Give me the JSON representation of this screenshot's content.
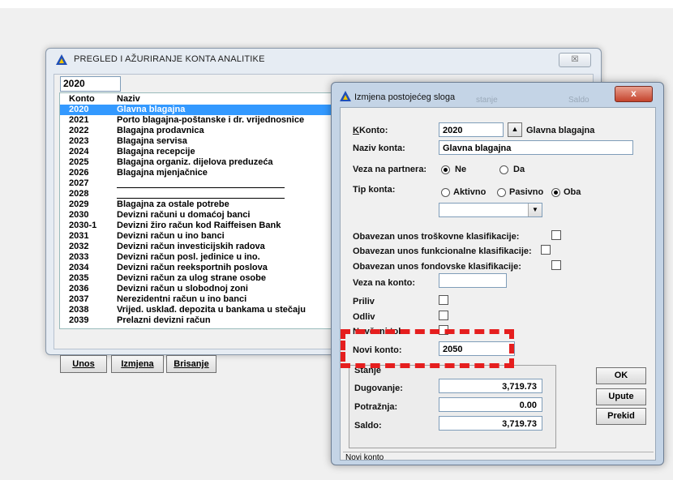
{
  "main_window": {
    "title": "PREGLED I AŽURIRANJE KONTA ANALITIKE",
    "close_label": "☒",
    "filter_value": "2020",
    "columns": {
      "konto": "Konto",
      "naziv": "Naziv"
    },
    "rows": [
      {
        "konto": "2020",
        "naziv": "Glavna blagajna",
        "selected": true
      },
      {
        "konto": "2021",
        "naziv": "Porto blagajna-poštanske i dr. vrijednosnice"
      },
      {
        "konto": "2022",
        "naziv": "Blagajna prodavnica"
      },
      {
        "konto": "2023",
        "naziv": "Blagajna servisa"
      },
      {
        "konto": "2024",
        "naziv": "Blagajna recepcije"
      },
      {
        "konto": "2025",
        "naziv": "Blagajna organiz. dijelova preduzeća"
      },
      {
        "konto": "2026",
        "naziv": "Blagajna mjenjačnice"
      },
      {
        "konto": "2027",
        "naziv": ""
      },
      {
        "konto": "2028",
        "naziv": ""
      },
      {
        "konto": "2029",
        "naziv": "Blagajna za ostale potrebe"
      },
      {
        "konto": "2030",
        "naziv": "Devizni računi u domaćoj banci"
      },
      {
        "konto": "2030-1",
        "naziv": "Devizni žiro račun kod Raiffeisen Bank"
      },
      {
        "konto": "2031",
        "naziv": "Devizni račun u ino banci"
      },
      {
        "konto": "2032",
        "naziv": "Devizni račun investicijskih radova"
      },
      {
        "konto": "2033",
        "naziv": "Devizni račun posl. jedinice u ino."
      },
      {
        "konto": "2034",
        "naziv": "Devizni račun reeksportnih poslova"
      },
      {
        "konto": "2035",
        "naziv": "Devizni račun za ulog strane osobe"
      },
      {
        "konto": "2036",
        "naziv": "Devizni račun u slobodnoj zoni"
      },
      {
        "konto": "2037",
        "naziv": "Nerezidentni račun u ino banci"
      },
      {
        "konto": "2038",
        "naziv": "Vrijed. usklađ. depozita u bankama u stečaju"
      },
      {
        "konto": "2039",
        "naziv": "Prelazni devizni račun"
      }
    ],
    "buttons": {
      "unos": "Unos",
      "izmjena": "Izmjena",
      "brisanje": "Brisanje"
    }
  },
  "dialog": {
    "title": "Izmjena postojećeg sloga",
    "close_label": "x",
    "ghost_left": "stanje",
    "ghost_right": "Saldo",
    "konto_label": "Konto:",
    "konto_value": "2020",
    "konto_name": "Glavna blagajna",
    "naziv_label": "Naziv konta:",
    "naziv_value": "Glavna blagajna",
    "veza_partnera_label": "Veza na partnera:",
    "veza_ne": "Ne",
    "veza_da": "Da",
    "tip_konta_label": "Tip konta:",
    "tip_aktivno": "Aktivno",
    "tip_pasivno": "Pasivno",
    "tip_oba": "Oba",
    "obavezan_troskovne": "Obavezan unos troškovne klasifikacije:",
    "obavezan_funkcionalne": "Obavezan unos funkcionalne klasifikacije:",
    "obavezan_fondovske": "Obavezan unos fondovske klasifikacije:",
    "veza_konto_label": "Veza na konto:",
    "priliv_label": "Priliv",
    "odliv_label": "Odliv",
    "novcani_tok_label": "Novčani tok",
    "novi_konto_label": "Novi konto:",
    "novi_konto_value": "2050",
    "stanje_label": "Stanje",
    "dugovanje_label": "Dugovanje:",
    "dugovanje_value": "3,719.73",
    "potrazna_label": "Potražnja:",
    "potrazna_value": "0.00",
    "saldo_label": "Saldo:",
    "saldo_value": "3,719.73",
    "ok_label": "OK",
    "upute_label": "Upute",
    "prekid_label": "Prekid",
    "status_text": "Novi konto"
  }
}
